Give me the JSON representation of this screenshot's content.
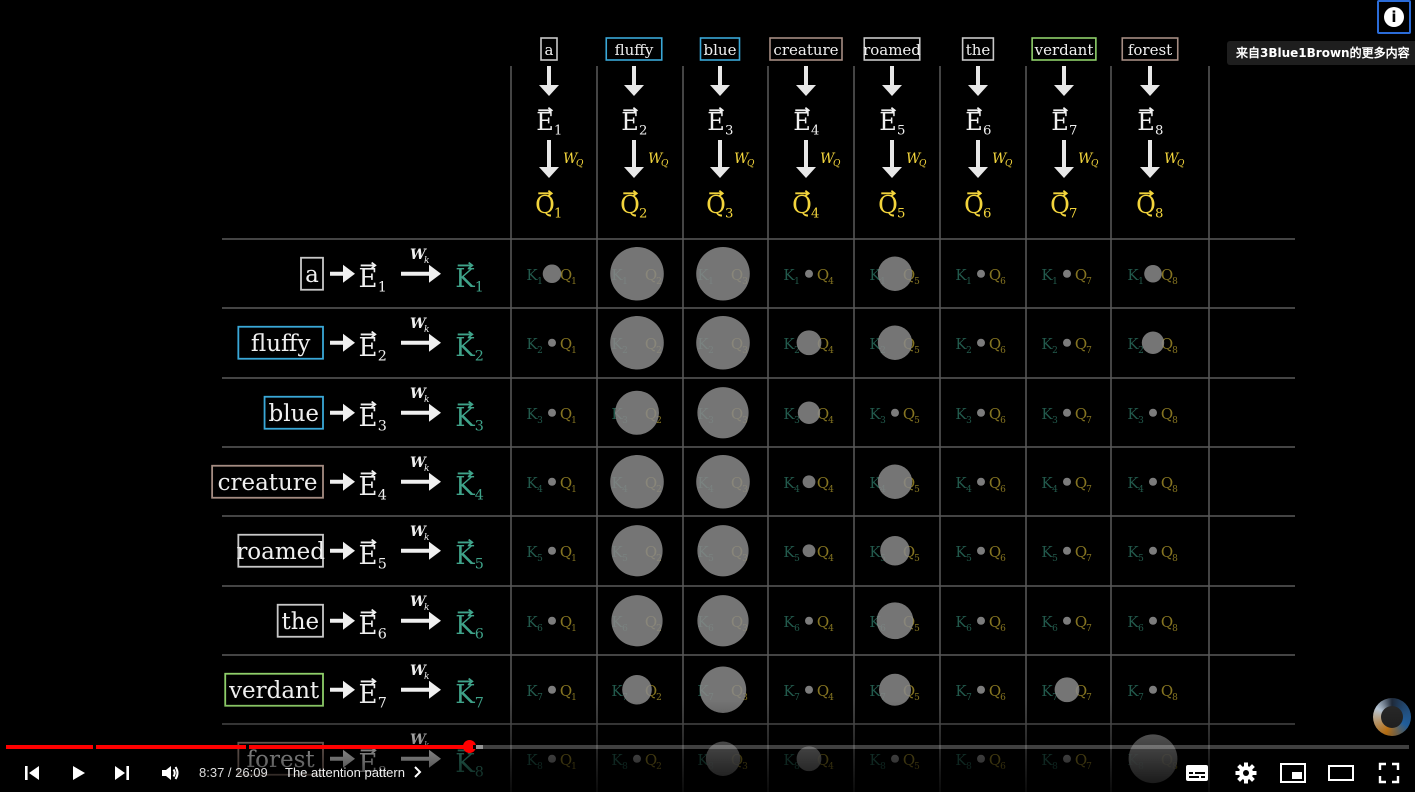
{
  "scene": {
    "words": [
      {
        "text": "a",
        "color": "#c8c8c8",
        "size": 0.35
      },
      {
        "text": "fluffy",
        "color": "#3aa8d8",
        "size": 0.75
      },
      {
        "text": "blue",
        "color": "#3aa8d8",
        "size": 0.75
      },
      {
        "text": "creature",
        "color": "#a58c82",
        "size": 0.7
      },
      {
        "text": "roamed",
        "color": "#c8c8c8",
        "size": 0.65
      },
      {
        "text": "the",
        "color": "#c8c8c8",
        "size": 0.6
      },
      {
        "text": "verdant",
        "color": "#8fcf6a",
        "size": 0.55
      },
      {
        "text": "forest",
        "color": "#a58c82",
        "size": 0.55
      }
    ],
    "embedding_symbol": "E",
    "query_symbol": "Q",
    "key_symbol": "K",
    "query_matrix_label": "WQ",
    "key_matrix_label": "Wk",
    "query_color": "#f2d43c",
    "key_color": "#3fa38a",
    "weights": [
      [
        0.22,
        0.95,
        0.95,
        0.0,
        0.55,
        0.0,
        0.0,
        0.2
      ],
      [
        0.0,
        0.95,
        0.95,
        0.35,
        0.55,
        0.0,
        0.0,
        0.3
      ],
      [
        0.0,
        0.75,
        0.9,
        0.3,
        0.0,
        0.0,
        0.0,
        0.0
      ],
      [
        0.0,
        0.95,
        0.95,
        0.1,
        0.55,
        0.0,
        0.0,
        0.0
      ],
      [
        0.0,
        0.9,
        0.9,
        0.1,
        0.45,
        0.0,
        0.0,
        0.0
      ],
      [
        0.0,
        0.9,
        0.9,
        0.0,
        0.6,
        0.0,
        0.0,
        0.0
      ],
      [
        0.0,
        0.45,
        0.8,
        0.0,
        0.5,
        0.0,
        0.35,
        0.0
      ],
      [
        0.0,
        0.0,
        0.55,
        0.35,
        0.0,
        0.0,
        0.0,
        0.85
      ]
    ],
    "weights_note": "circle scale per cell (rows = keys, cols = queries)"
  },
  "overlay": {
    "info_icon": "info-icon",
    "more_from_channel": "来自3Blue1Brown的更多内容"
  },
  "player": {
    "current_time": "8:37",
    "duration": "26:09",
    "time_display": "8:37 / 26:09",
    "chapter_title": "The attention pattern",
    "progress_fraction": 0.33,
    "loaded_fraction": 0.34,
    "chapter_marks": [
      0.062,
      0.171,
      0.333
    ],
    "buttons": {
      "prev": "skip-previous-icon",
      "play": "play-icon",
      "next": "skip-next-icon",
      "volume": "volume-icon",
      "subtitles": "subtitles-icon",
      "settings": "gear-icon",
      "miniplayer": "miniplayer-icon",
      "theater": "theater-mode-icon",
      "fullscreen": "fullscreen-icon"
    },
    "accent_color": "#ff0000"
  }
}
